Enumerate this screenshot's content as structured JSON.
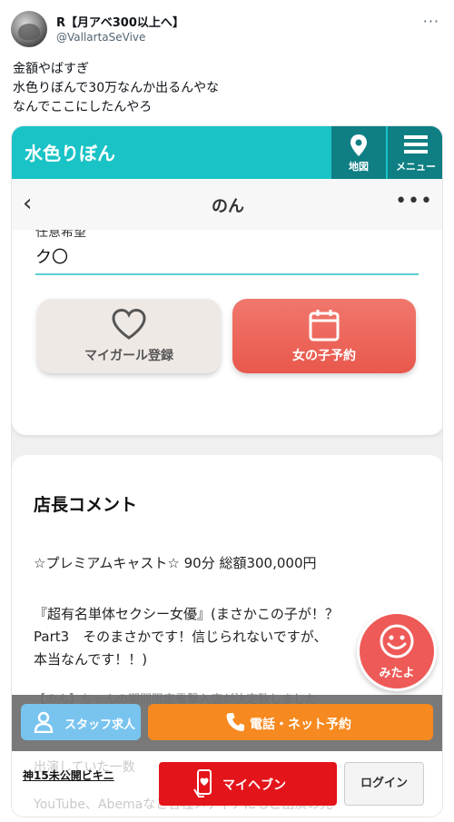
{
  "tweet": {
    "user_name": "R【月アベ300以上へ】",
    "handle": "@VallartaSeVive",
    "lines": [
      "金額やばすぎ",
      "水色りぼんで30万なんか出るんやな",
      "なんでここにしたんやろ"
    ],
    "more": "···"
  },
  "app": {
    "title": "水色りぼん",
    "map_label": "地図",
    "menu_label": "メニュー",
    "nav_title": "のん",
    "back": "‹",
    "nav_more": "•••",
    "field_label_cut": "任意希望",
    "field_value": "ク〇",
    "my_girl_label": "マイガール登録",
    "reserve_label": "女の子予約",
    "section_title": "店長コメント",
    "comment_lines": [
      "☆プレミアムキャスト☆ 90分 総額300,000円",
      "『超有名単体セクシー女優』(まさかこの子が！？",
      "Part3　そのまさかです！信じられないですが、",
      "本当なんです！！)"
    ],
    "stripe_text": "【のん】ちゃんの期間限定電撃入店が決定致しました",
    "mitayo_label": "みたよ",
    "staff_label": "スタッフ求人",
    "tel_label": "電話・ネット予約",
    "bikini_link": "神15未公開ビキニ",
    "ghost_top": "出演していた一数",
    "ghost_bottom": "YouTube、Abemaなど各種メディアにもご出演の元",
    "myheaven_label": "マイヘブン",
    "login_label": "ログイン"
  },
  "colors": {
    "teal": "#19c3c6",
    "teal_dark": "#0f7f84",
    "coral": "#e9584c",
    "orange": "#f6891f",
    "sky": "#79c4ef",
    "red": "#e3141a"
  },
  "icons": [
    "map-pin-icon",
    "hamburger-menu-icon",
    "heart-icon",
    "calendar-icon",
    "smiley-icon",
    "person-icon",
    "phone-icon",
    "phone-heart-icon"
  ]
}
